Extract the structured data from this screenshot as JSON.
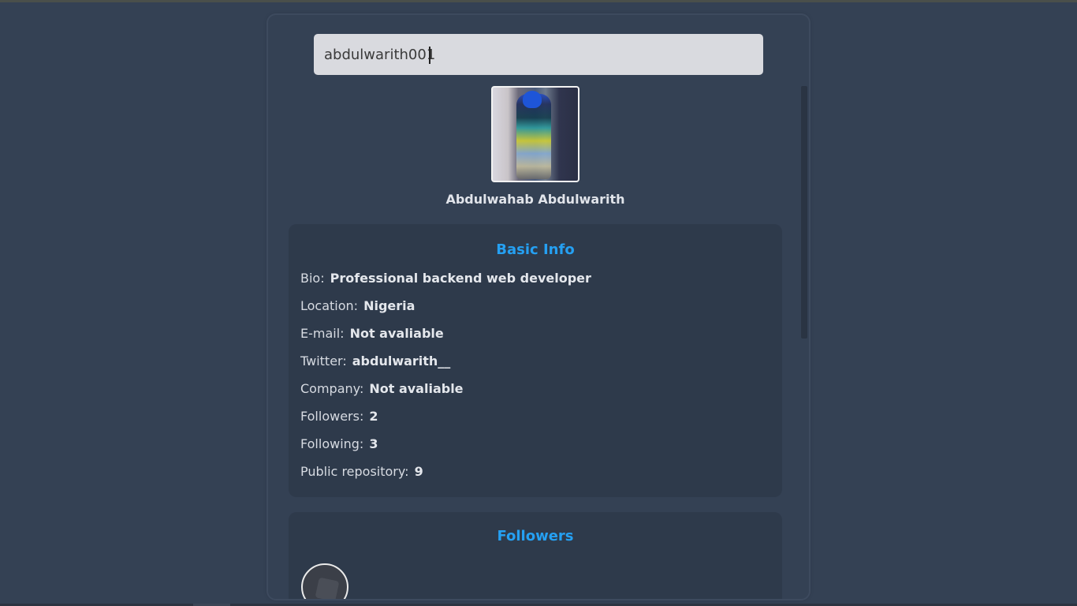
{
  "search": {
    "value": "abdulwarith001"
  },
  "profile": {
    "avatar_alt": "Abdulwahab Abdulwarith avatar",
    "name": "Abdulwahab Abdulwarith"
  },
  "basic_info": {
    "title": "Basic Info",
    "rows": [
      {
        "label": "Bio:",
        "value": "Professional backend web developer"
      },
      {
        "label": "Location:",
        "value": "Nigeria"
      },
      {
        "label": "E-mail:",
        "value": "Not avaliable"
      },
      {
        "label": "Twitter:",
        "value": "abdulwarith__"
      },
      {
        "label": "Company:",
        "value": "Not avaliable"
      },
      {
        "label": "Followers:",
        "value": "2"
      },
      {
        "label": "Following:",
        "value": "3"
      },
      {
        "label": "Public repository:",
        "value": "9"
      }
    ]
  },
  "followers": {
    "title": "Followers"
  },
  "colors": {
    "background": "#344154",
    "card": "#2e3a4b",
    "accent": "#25a0f2",
    "text": "#d7dbe2"
  }
}
